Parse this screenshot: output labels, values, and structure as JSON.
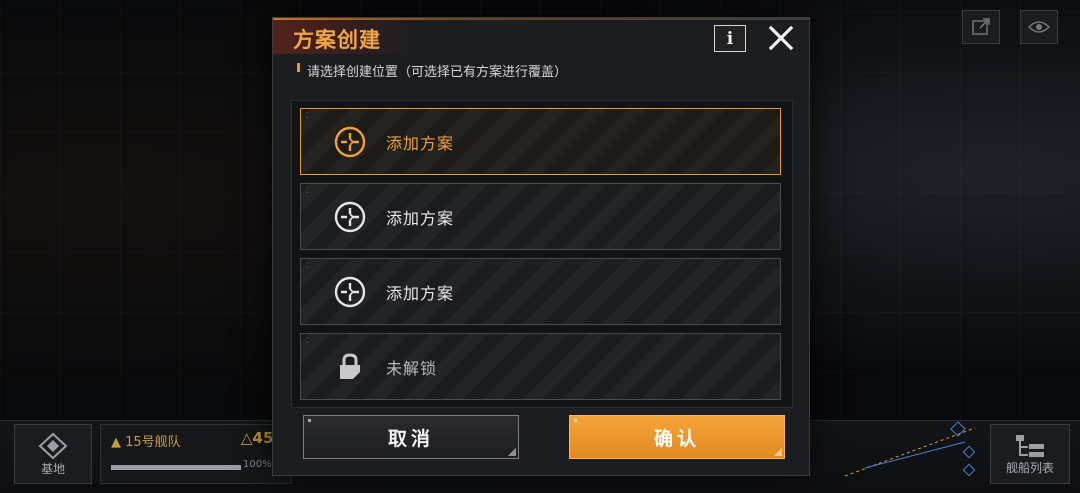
{
  "dialog": {
    "title": "方案创建",
    "info_label": "i",
    "subtitle": "请选择创建位置（可选择已有方案进行覆盖）",
    "slots": [
      {
        "label": "添加方案",
        "state": "selected",
        "icon": "add-crosshair-icon"
      },
      {
        "label": "添加方案",
        "state": "empty",
        "icon": "add-crosshair-icon"
      },
      {
        "label": "添加方案",
        "state": "empty",
        "icon": "add-crosshair-icon"
      },
      {
        "label": "未解锁",
        "state": "locked",
        "icon": "lock-icon"
      }
    ],
    "cancel_label": "取消",
    "confirm_label": "确认"
  },
  "background": {
    "base_label": "基地",
    "fleet_name": "15号舰队",
    "fleet_power": "△45",
    "fleet_progress_percent": 100,
    "fleet_progress_text": "100%",
    "ship_list_label": "舰船列表"
  },
  "colors": {
    "accent": "#f0a040",
    "confirm_bg": "#ea9226",
    "dialog_bg": "#1c1d20"
  }
}
